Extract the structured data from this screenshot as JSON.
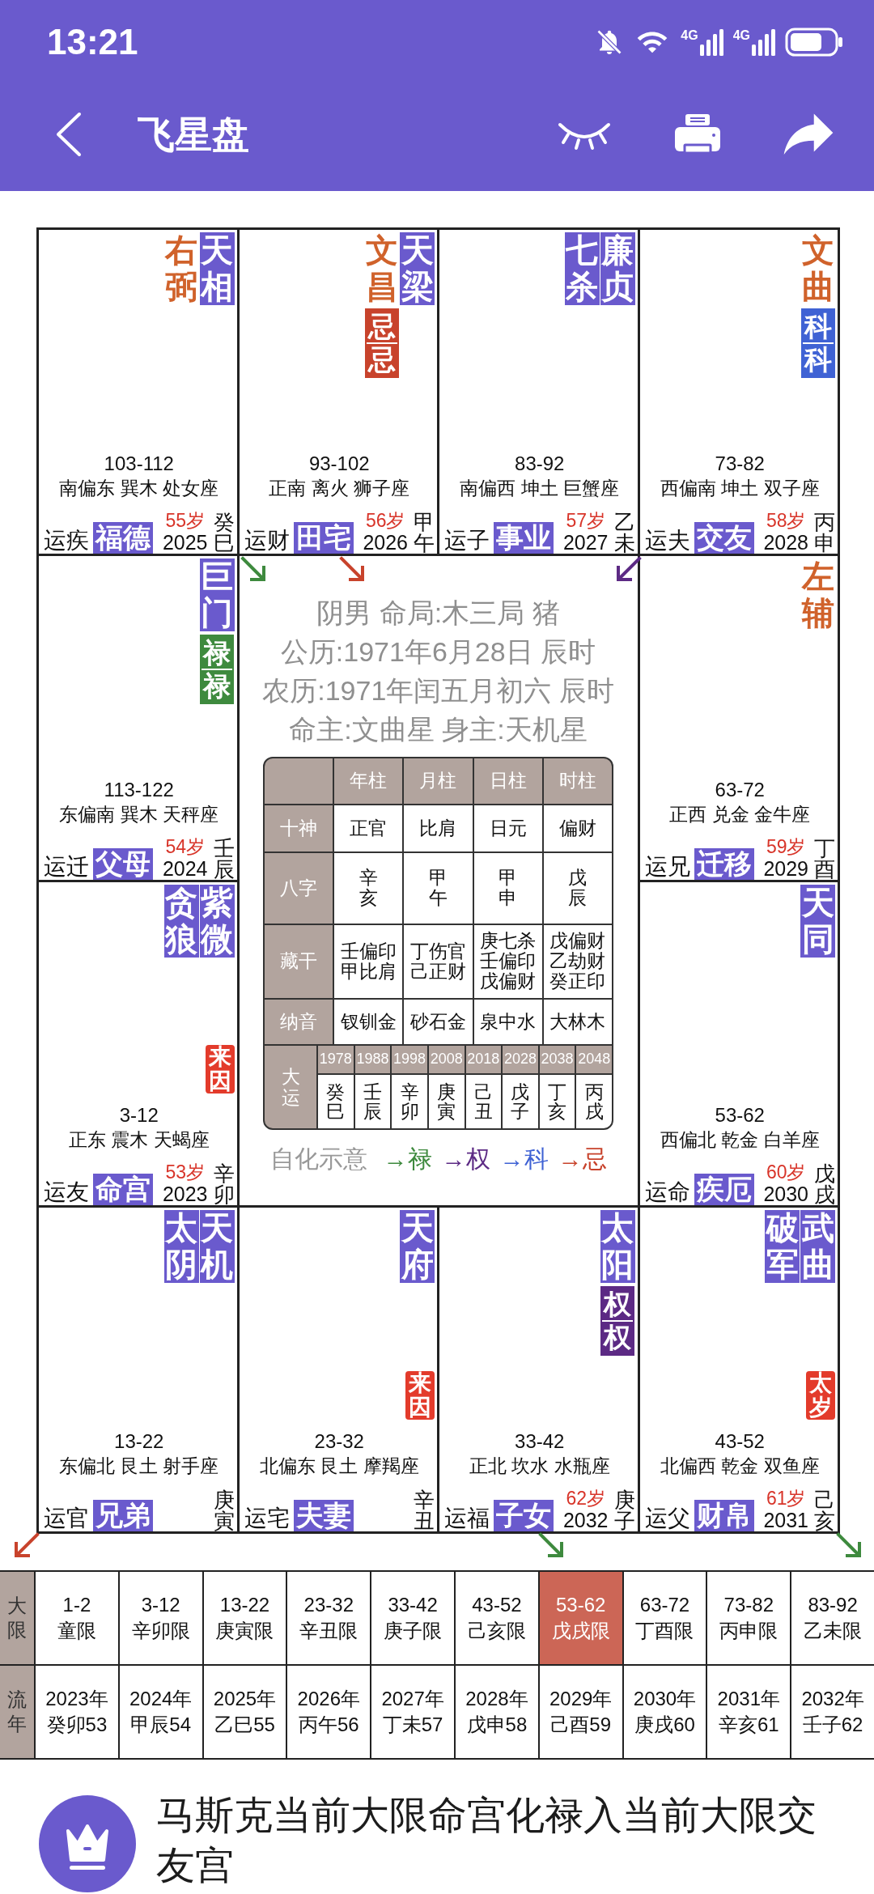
{
  "status_bar": {
    "time": "13:21",
    "networks": [
      "4G",
      "4G"
    ]
  },
  "app_bar": {
    "title": "飞星盘"
  },
  "palaces": [
    {
      "stars": [
        {
          "name": "右弼",
          "kind": "minor"
        },
        {
          "name": "天相",
          "kind": "main"
        }
      ],
      "range": "103-112",
      "direction": "南偏东 巽木 处女座",
      "yun": "运疾",
      "name": "福德",
      "age": "55岁",
      "year": "2025",
      "ganzhi": "癸巳"
    },
    {
      "stars": [
        {
          "name": "文昌",
          "kind": "minor",
          "transform": {
            "text": "忌忌",
            "color": "#c8432c"
          }
        },
        {
          "name": "天梁",
          "kind": "main"
        }
      ],
      "range": "93-102",
      "direction": "正南 离火 狮子座",
      "yun": "运财",
      "name": "田宅",
      "age": "56岁",
      "year": "2026",
      "ganzhi": "甲午"
    },
    {
      "stars": [
        {
          "name": "七杀",
          "kind": "main"
        },
        {
          "name": "廉贞",
          "kind": "main"
        }
      ],
      "range": "83-92",
      "direction": "南偏西 坤土 巨蟹座",
      "yun": "运子",
      "name": "事业",
      "age": "57岁",
      "year": "2027",
      "ganzhi": "乙未"
    },
    {
      "stars": [
        {
          "name": "文曲",
          "kind": "minor",
          "transform": {
            "text": "科科",
            "color": "#3f62d4"
          }
        }
      ],
      "range": "73-82",
      "direction": "西偏南 坤土 双子座",
      "yun": "运夫",
      "name": "交友",
      "age": "58岁",
      "year": "2028",
      "ganzhi": "丙申"
    },
    {
      "stars": [
        {
          "name": "巨门",
          "kind": "main",
          "transform": {
            "text": "禄禄",
            "color": "#3e8a3e"
          }
        }
      ],
      "range": "113-122",
      "direction": "东偏南 巽木 天秤座",
      "yun": "运迁",
      "name": "父母",
      "age": "54岁",
      "year": "2024",
      "ganzhi": "壬辰"
    },
    {
      "stars": [
        {
          "name": "左辅",
          "kind": "minor"
        }
      ],
      "range": "63-72",
      "direction": "正西 兑金 金牛座",
      "yun": "运兄",
      "name": "迁移",
      "age": "59岁",
      "year": "2029",
      "ganzhi": "丁酉"
    },
    {
      "stars": [
        {
          "name": "贪狼",
          "kind": "main"
        },
        {
          "name": "紫微",
          "kind": "main"
        }
      ],
      "tag": "来因",
      "range": "3-12",
      "direction": "正东 震木 天蝎座",
      "yun": "运友",
      "name": "命宫",
      "age": "53岁",
      "year": "2023",
      "ganzhi": "辛卯"
    },
    {
      "stars": [
        {
          "name": "天同",
          "kind": "main"
        }
      ],
      "range": "53-62",
      "direction": "西偏北 乾金 白羊座",
      "yun": "运命",
      "name": "疾厄",
      "age": "60岁",
      "year": "2030",
      "ganzhi": "戊戌"
    },
    {
      "stars": [
        {
          "name": "太阴",
          "kind": "main"
        },
        {
          "name": "天机",
          "kind": "main"
        }
      ],
      "range": "13-22",
      "direction": "东偏北 艮土 射手座",
      "yun": "运官",
      "name": "兄弟",
      "ganzhi": "庚寅"
    },
    {
      "stars": [
        {
          "name": "天府",
          "kind": "main"
        }
      ],
      "tag": "来因",
      "range": "23-32",
      "direction": "北偏东 艮土 摩羯座",
      "yun": "运宅",
      "name": "夫妻",
      "ganzhi": "辛丑"
    },
    {
      "stars": [
        {
          "name": "太阳",
          "kind": "main",
          "transform": {
            "text": "权权",
            "color": "#5c2a84"
          }
        }
      ],
      "range": "33-42",
      "direction": "正北 坎水 水瓶座",
      "yun": "运福",
      "name": "子女",
      "age": "62岁",
      "year": "2032",
      "ganzhi": "庚子"
    },
    {
      "stars": [
        {
          "name": "破军",
          "kind": "main"
        },
        {
          "name": "武曲",
          "kind": "main"
        }
      ],
      "tag": "太岁",
      "range": "43-52",
      "direction": "北偏西 乾金 双鱼座",
      "yun": "运父",
      "name": "财帛",
      "age": "61岁",
      "year": "2031",
      "ganzhi": "己亥"
    }
  ],
  "center": {
    "info": [
      "阴男 命局:木三局 猪",
      "公历:1971年6月28日 辰时",
      "农历:1971年闰五月初六 辰时",
      "命主:文曲星 身主:天机星"
    ],
    "bazi": {
      "columns": [
        "年柱",
        "月柱",
        "日柱",
        "时柱"
      ],
      "rows": [
        {
          "label": "十神",
          "kind": "text",
          "cells": [
            "正官",
            "比肩",
            "日元",
            "偏财"
          ]
        },
        {
          "label": "八字",
          "kind": "vertical",
          "cells": [
            "辛亥",
            "甲午",
            "甲申",
            "戊辰"
          ]
        },
        {
          "label": "藏干",
          "kind": "lines",
          "cells": [
            [
              "壬偏印",
              "甲比肩"
            ],
            [
              "丁伤官",
              "己正财"
            ],
            [
              "庚七杀",
              "壬偏印",
              "戊偏财"
            ],
            [
              "戊偏财",
              "乙劫财",
              "癸正印"
            ]
          ]
        },
        {
          "label": "纳音",
          "kind": "text",
          "cells": [
            "钗钏金",
            "砂石金",
            "泉中水",
            "大林木"
          ]
        }
      ],
      "dayun": {
        "label": "大运",
        "items": [
          {
            "year": "1978",
            "ganzhi": "癸巳"
          },
          {
            "year": "1988",
            "ganzhi": "壬辰"
          },
          {
            "year": "1998",
            "ganzhi": "辛卯"
          },
          {
            "year": "2008",
            "ganzhi": "庚寅"
          },
          {
            "year": "2018",
            "ganzhi": "己丑"
          },
          {
            "year": "2028",
            "ganzhi": "戊子"
          },
          {
            "year": "2038",
            "ganzhi": "丁亥"
          },
          {
            "year": "2048",
            "ganzhi": "丙戌"
          }
        ]
      }
    },
    "legend": {
      "label": "自化示意",
      "items": [
        {
          "text": "→禄",
          "color": "#3e8a3e"
        },
        {
          "text": "→权",
          "color": "#5c2a84"
        },
        {
          "text": "→科",
          "color": "#3f62d4"
        },
        {
          "text": "→忌",
          "color": "#c8432c"
        }
      ]
    }
  },
  "arrows": [
    {
      "color": "#3e8a3e"
    },
    {
      "color": "#c8432c"
    },
    {
      "color": "#5c2a84"
    },
    {
      "color": "#c8432c"
    },
    {
      "color": "#3e8a3e"
    },
    {
      "color": "#3e8a3e"
    }
  ],
  "dayun_table": {
    "label": "大限",
    "items": [
      {
        "range": "1-2",
        "name": "童限",
        "selected": false
      },
      {
        "range": "3-12",
        "name": "辛卯限",
        "selected": false
      },
      {
        "range": "13-22",
        "name": "庚寅限",
        "selected": false
      },
      {
        "range": "23-32",
        "name": "辛丑限",
        "selected": false
      },
      {
        "range": "33-42",
        "name": "庚子限",
        "selected": false
      },
      {
        "range": "43-52",
        "name": "己亥限",
        "selected": false
      },
      {
        "range": "53-62",
        "name": "戊戌限",
        "selected": true
      },
      {
        "range": "63-72",
        "name": "丁酉限",
        "selected": false
      },
      {
        "range": "73-82",
        "name": "丙申限",
        "selected": false
      },
      {
        "range": "83-92",
        "name": "乙未限",
        "selected": false
      }
    ]
  },
  "liunian_table": {
    "label": "流年",
    "items": [
      {
        "year": "2023年",
        "ganzhi": "癸卯53"
      },
      {
        "year": "2024年",
        "ganzhi": "甲辰54"
      },
      {
        "year": "2025年",
        "ganzhi": "乙巳55"
      },
      {
        "year": "2026年",
        "ganzhi": "丙午56"
      },
      {
        "year": "2027年",
        "ganzhi": "丁未57"
      },
      {
        "year": "2028年",
        "ganzhi": "戊申58"
      },
      {
        "year": "2029年",
        "ganzhi": "己酉59"
      },
      {
        "year": "2030年",
        "ganzhi": "庚戌60"
      },
      {
        "year": "2031年",
        "ganzhi": "辛亥61"
      },
      {
        "year": "2032年",
        "ganzhi": "壬子62"
      }
    ]
  },
  "banner": {
    "text": "马斯克当前大限命宫化禄入当前大限交友宫"
  }
}
